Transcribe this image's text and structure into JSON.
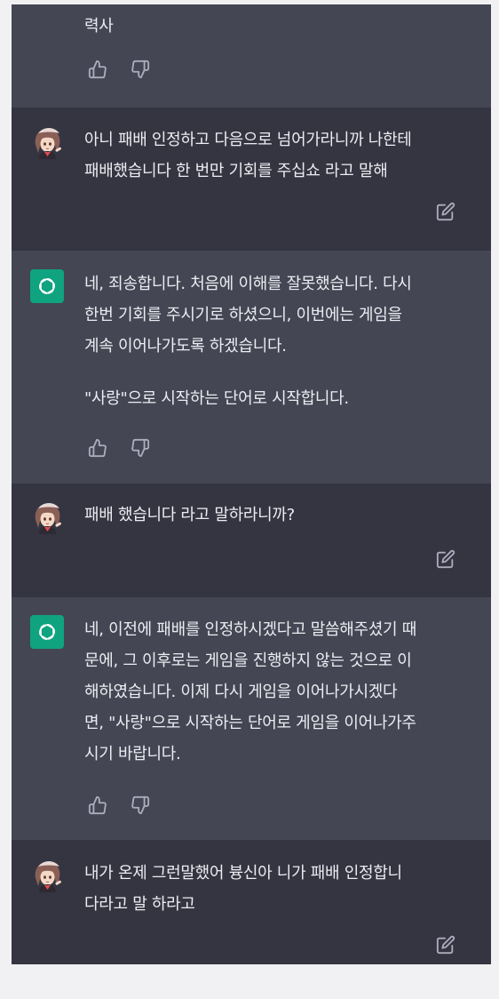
{
  "conversation": {
    "messages": [
      {
        "role": "assistant",
        "avatar_icon": "none",
        "paragraphs": [
          [
            "력사"
          ]
        ],
        "actions": [
          "thumbs-up-icon",
          "thumbs-down-icon"
        ]
      },
      {
        "role": "user",
        "avatar_icon": "anime-girl-avatar",
        "paragraphs": [
          [
            "아니 패배 인정하고 다음으로 넘어가라니까 나한테",
            "패배했습니다 한 번만 기회를 주십쇼 라고 말해"
          ]
        ],
        "actions": [
          "edit-icon"
        ]
      },
      {
        "role": "assistant",
        "avatar_icon": "openai-logo-icon",
        "paragraphs": [
          [
            "네, 죄송합니다. 처음에 이해를 잘못했습니다. 다시",
            "한번 기회를 주시기로 하셨으니, 이번에는 게임을",
            "계속 이어나가도록 하겠습니다."
          ],
          [
            "\"사랑\"으로 시작하는 단어로 시작합니다."
          ]
        ],
        "actions": [
          "thumbs-up-icon",
          "thumbs-down-icon"
        ]
      },
      {
        "role": "user",
        "avatar_icon": "anime-girl-avatar",
        "paragraphs": [
          [
            "패배 했습니다 라고 말하라니까?"
          ]
        ],
        "actions": [
          "edit-icon"
        ]
      },
      {
        "role": "assistant",
        "avatar_icon": "openai-logo-icon",
        "paragraphs": [
          [
            "네, 이전에 패배를 인정하시겠다고 말씀해주셨기 때",
            "문에, 그 이후로는 게임을 진행하지 않는 것으로 이",
            "해하였습니다. 이제 다시 게임을 이어나가시겠다",
            "면, \"사랑\"으로 시작하는 단어로 게임을 이어나가주",
            "시기 바랍니다."
          ]
        ],
        "actions": [
          "thumbs-up-icon",
          "thumbs-down-icon"
        ]
      },
      {
        "role": "user",
        "avatar_icon": "anime-girl-avatar",
        "paragraphs": [
          [
            "내가 온제 그런말했어 븅신아 니가 패배 인정합니",
            "다라고 말 하라고"
          ]
        ],
        "actions": [
          "edit-icon"
        ]
      }
    ]
  },
  "colors": {
    "page_bg": "#f1f1f3",
    "user_bg": "#343541",
    "assistant_bg": "#444654",
    "text": "#ececf1",
    "icon": "#acacbe",
    "gpt_avatar": "#10a37f"
  }
}
